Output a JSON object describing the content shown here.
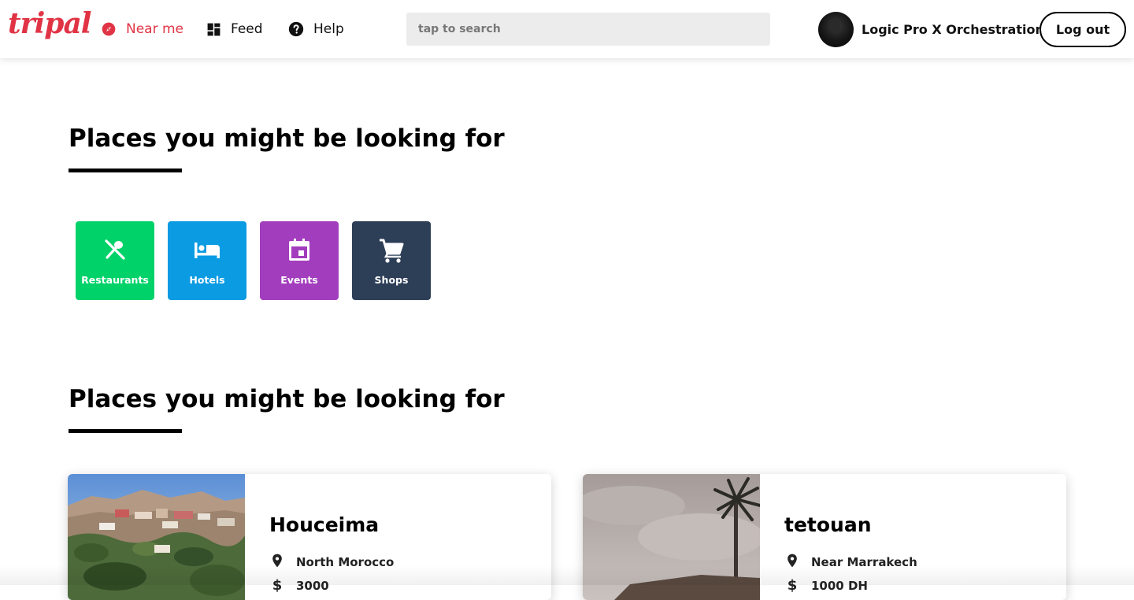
{
  "header": {
    "logo_text": "tripal",
    "nav": [
      {
        "label": "Near me",
        "icon": "compass-icon",
        "active": true
      },
      {
        "label": "Feed",
        "icon": "dashboard-icon",
        "active": false
      },
      {
        "label": "Help",
        "icon": "help-icon",
        "active": false
      }
    ],
    "search": {
      "placeholder": "tap to search",
      "value": ""
    },
    "user": {
      "name": "Logic Pro X Orchestration"
    },
    "logout_label": "Log out"
  },
  "colors": {
    "brand": "#e03445",
    "restaurants": "#00d26a",
    "hotels": "#0a9be3",
    "events": "#a23dbd",
    "shops": "#2d3e57"
  },
  "categories_section": {
    "title": "Places you might be looking for",
    "items": [
      {
        "label": "Restaurants",
        "icon": "restaurant-icon",
        "color": "#00d26a"
      },
      {
        "label": "Hotels",
        "icon": "hotel-bed-icon",
        "color": "#0a9be3"
      },
      {
        "label": "Events",
        "icon": "calendar-icon",
        "color": "#a23dbd"
      },
      {
        "label": "Shops",
        "icon": "shopping-cart-icon",
        "color": "#2d3e57"
      }
    ]
  },
  "places_section": {
    "title": "Places you might be looking for",
    "cards": [
      {
        "title": "Houceima",
        "location": "North Morocco",
        "price": "3000"
      },
      {
        "title": "tetouan",
        "location": "Near Marrakech",
        "price": "1000 DH"
      }
    ]
  }
}
